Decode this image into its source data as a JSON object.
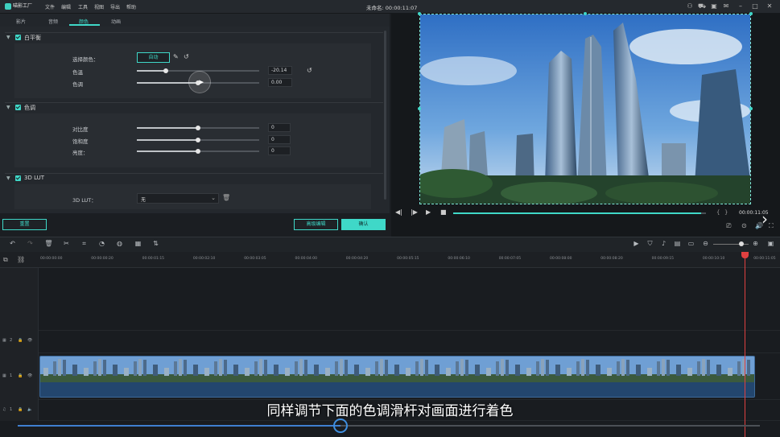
{
  "app": {
    "logo_text": "喵影工厂",
    "menu": [
      "文件",
      "编辑",
      "工具",
      "视图",
      "导出",
      "帮助"
    ],
    "doc_title": "未命名: 00:00:11:07"
  },
  "titlebar_icons": [
    "user-icon",
    "cart-icon",
    "save-icon",
    "mail-icon",
    "minimize-icon",
    "maximize-icon",
    "close-icon"
  ],
  "tabs": [
    "影片",
    "音频",
    "颜色",
    "动画"
  ],
  "active_tab": "颜色",
  "white_balance": {
    "title": "白平衡",
    "select_color_label": "选择颜色：",
    "auto_label": "自动",
    "temp_label": "色温",
    "temp_value": "-20.14",
    "temp_level": 0.24,
    "tint_label": "色调",
    "tint_value": "0.00",
    "tint_level": 0.5
  },
  "tone": {
    "title": "色调",
    "contrast_label": "对比度",
    "contrast_value": "0",
    "contrast_level": 0.5,
    "saturation_label": "饱和度",
    "saturation_value": "0",
    "saturation_level": 0.5,
    "brightness_label": "亮度：",
    "brightness_value": "0",
    "brightness_level": 0.5
  },
  "lut": {
    "title": "3D LUT",
    "label": "3D LUT：",
    "selected": "无"
  },
  "buttons": {
    "reset": "重置",
    "advanced": "高级编辑",
    "ok": "确认"
  },
  "player": {
    "timecode": "00:00:11:05",
    "progress": 0.98
  },
  "ruler_ticks": [
    "00:00:00:00",
    "00:00:00:20",
    "00:00:01:15",
    "00:00:02:10",
    "00:00:03:05",
    "00:00:04:00",
    "00:00:04:20",
    "00:00:05:15",
    "00:00:06:10",
    "00:00:07:05",
    "00:00:08:00",
    "00:00:08:20",
    "00:00:09:15",
    "00:00:10:10",
    "00:00:11:05"
  ],
  "track_labels": [
    "2",
    "1",
    "1"
  ],
  "caption": "同样调节下面的色调滑杆对画面进行着色",
  "tutorial_progress": 0.435,
  "colors": {
    "accent": "#3fd8c8",
    "playhead": "#e04040",
    "clip": "#23466e"
  }
}
